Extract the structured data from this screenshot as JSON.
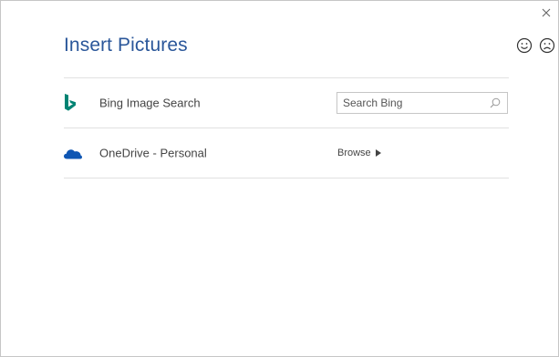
{
  "dialog": {
    "title": "Insert Pictures",
    "close_icon": "close-icon",
    "feedback": {
      "smile_icon": "smile-icon",
      "frown_icon": "frown-icon"
    }
  },
  "sources": [
    {
      "icon": "bing-icon",
      "label": "Bing Image Search",
      "search": {
        "placeholder": "Search Bing",
        "value": "",
        "icon": "search-icon"
      }
    },
    {
      "icon": "onedrive-cloud-icon",
      "label": "OneDrive - Personal",
      "action_label": "Browse",
      "action_icon": "triangle-right-icon"
    }
  ],
  "colors": {
    "title": "#2b579a",
    "bing": "#008373",
    "onedrive": "#0f56b3",
    "divider": "#e1e1e1",
    "text": "#444444"
  }
}
